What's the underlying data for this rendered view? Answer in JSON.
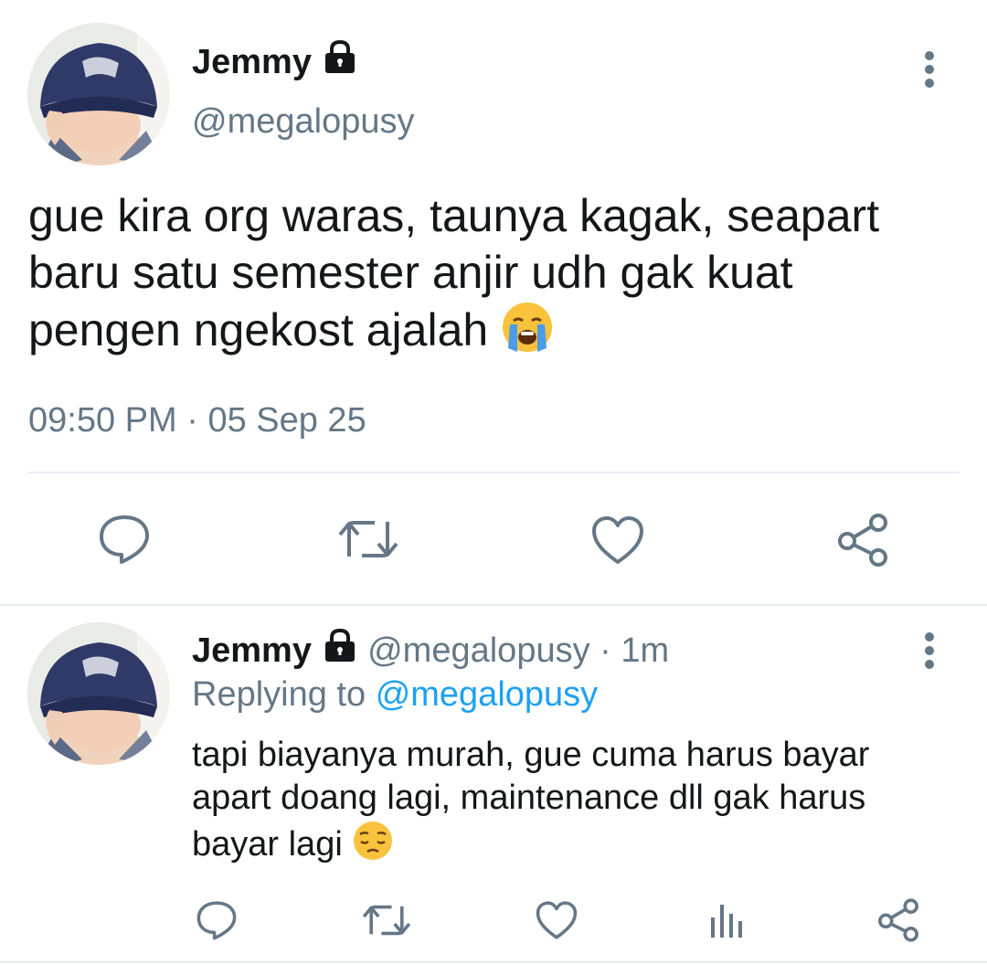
{
  "main_tweet": {
    "display_name": "Jemmy",
    "handle": "@megalopusy",
    "text": "gue kira org waras, taunya kagak, seapart baru satu semester anjir udh gak kuat pengen ngekost ajalah",
    "emoji": "loudly-crying-face",
    "time": "09:50 PM",
    "separator": "·",
    "date": "05 Sep 25",
    "actions": [
      "reply-icon",
      "retweet-icon",
      "like-icon",
      "share-icon"
    ]
  },
  "reply_tweet": {
    "display_name": "Jemmy",
    "handle": "@megalopusy",
    "separator": "·",
    "age": "1m",
    "replying_prefix": "Replying to",
    "replying_handle": "@megalopusy",
    "text": "tapi biayanya murah, gue cuma harus bayar apart doang lagi, maintenance dll gak harus bayar lagi",
    "emoji": "pensive-face",
    "actions": [
      "reply-icon",
      "retweet-icon",
      "like-icon",
      "analytics-icon",
      "share-icon"
    ]
  },
  "colors": {
    "text": "#14171a",
    "muted": "#657786",
    "link": "#1da1f2",
    "divider": "#e6ecf0"
  }
}
